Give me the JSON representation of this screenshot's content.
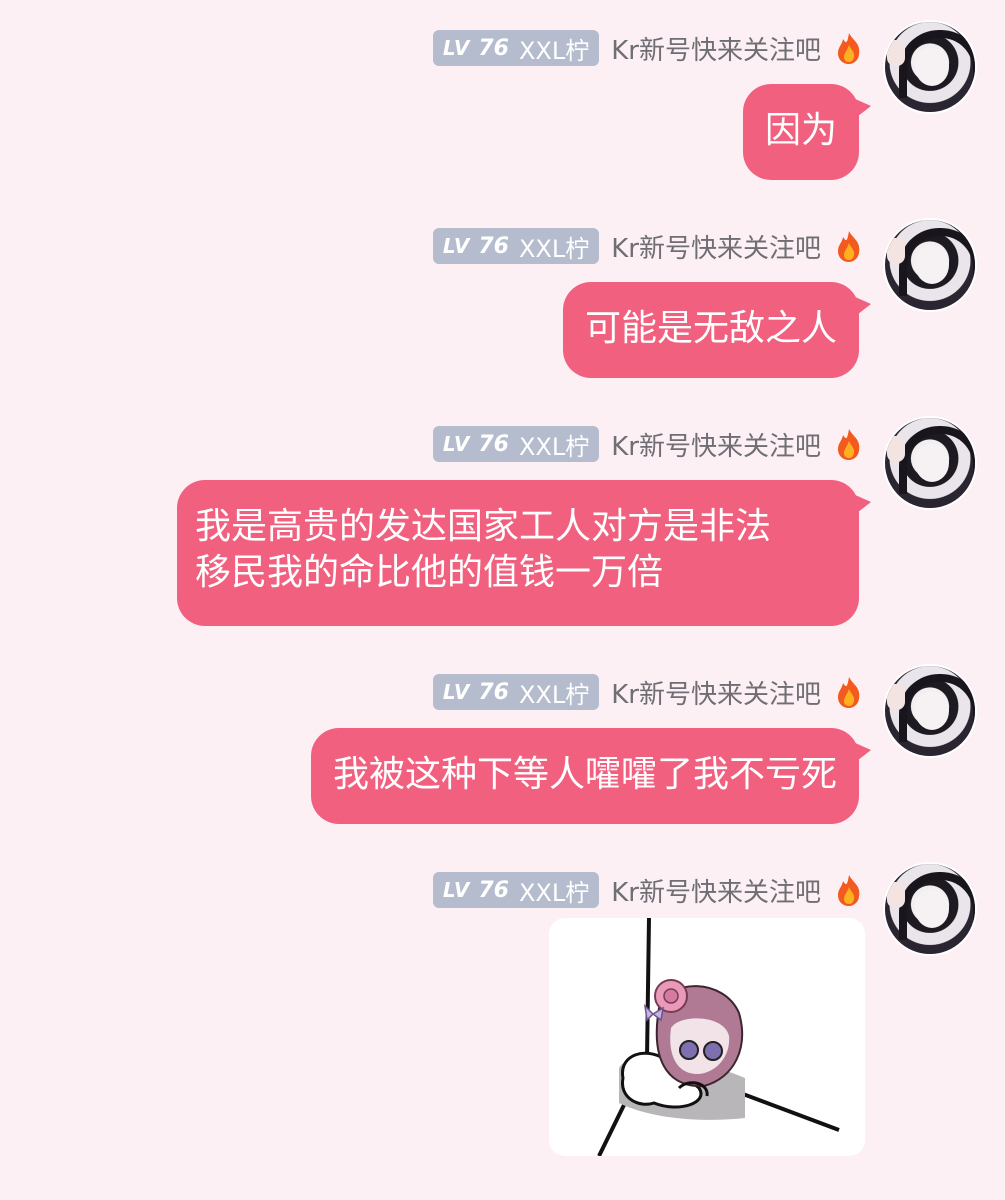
{
  "sender": {
    "level_prefix": "LV",
    "level_number": "76",
    "nickname": "XXL柠",
    "title": "Kr新号快来关注吧",
    "title_icon": "fire-icon",
    "badge_color": "#b5bccd",
    "bubble_color": "#f1607f"
  },
  "messages": [
    {
      "text": "因为"
    },
    {
      "text": "可能是无敌之人"
    },
    {
      "line1": "我是高贵的发达国家工人对方是非法",
      "line2": "移民我的命比他的值钱一万倍"
    },
    {
      "text": "我被这种下等人嚯嚯了我不亏死"
    },
    {
      "sticker": "sticker-image"
    }
  ]
}
